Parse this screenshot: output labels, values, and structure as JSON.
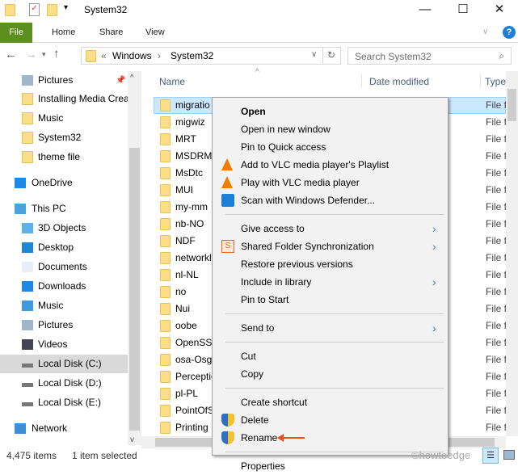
{
  "window": {
    "title": "System32",
    "minimize": "—",
    "maximize": "☐",
    "close": "✕"
  },
  "ribbon": {
    "tabs": [
      "File",
      "Home",
      "Share",
      "View"
    ],
    "help": "?"
  },
  "address": {
    "path": [
      "Windows",
      "System32"
    ],
    "prefix": "«",
    "search_placeholder": "Search System32"
  },
  "nav": [
    {
      "label": "Pictures",
      "icon": "pictures-icon",
      "pinned": true
    },
    {
      "label": "Installing Media Crea",
      "icon": "folder-icon"
    },
    {
      "label": "Music",
      "icon": "folder-icon"
    },
    {
      "label": "System32",
      "icon": "folder-icon"
    },
    {
      "label": "theme file",
      "icon": "folder-icon"
    },
    {
      "label": "OneDrive",
      "icon": "onedrive-icon"
    },
    {
      "label": "This PC",
      "icon": "this-pc-icon"
    },
    {
      "label": "3D Objects",
      "icon": "3d-objects-icon"
    },
    {
      "label": "Desktop",
      "icon": "desktop-icon"
    },
    {
      "label": "Documents",
      "icon": "documents-icon"
    },
    {
      "label": "Downloads",
      "icon": "downloads-icon"
    },
    {
      "label": "Music",
      "icon": "music-icon"
    },
    {
      "label": "Pictures",
      "icon": "pictures-icon"
    },
    {
      "label": "Videos",
      "icon": "videos-icon"
    },
    {
      "label": "Local Disk (C:)",
      "icon": "drive-icon",
      "selected": true
    },
    {
      "label": "Local Disk (D:)",
      "icon": "drive-icon"
    },
    {
      "label": "Local Disk (E:)",
      "icon": "drive-icon"
    },
    {
      "label": "Network",
      "icon": "network-icon"
    }
  ],
  "columns": {
    "name": "Name",
    "date": "Date modified",
    "type": "Type"
  },
  "files": [
    {
      "name": "migratio",
      "type": "File f"
    },
    {
      "name": "migwiz",
      "type": "File f"
    },
    {
      "name": "MRT",
      "type": "File f"
    },
    {
      "name": "MSDRM",
      "type": "File f"
    },
    {
      "name": "MsDtc",
      "type": "File f"
    },
    {
      "name": "MUI",
      "type": "File f"
    },
    {
      "name": "my-mm",
      "type": "File f"
    },
    {
      "name": "nb-NO",
      "type": "File f"
    },
    {
      "name": "NDF",
      "type": "File f"
    },
    {
      "name": "networkl",
      "type": "File f"
    },
    {
      "name": "nl-NL",
      "type": "File f"
    },
    {
      "name": "no",
      "type": "File f"
    },
    {
      "name": "Nui",
      "type": "File f"
    },
    {
      "name": "oobe",
      "type": "File f"
    },
    {
      "name": "OpenSSH",
      "type": "File f"
    },
    {
      "name": "osa-Osg",
      "type": "File f"
    },
    {
      "name": "Perceptio",
      "type": "File f"
    },
    {
      "name": "pl-PL",
      "type": "File f"
    },
    {
      "name": "PointOfS",
      "type": "File f"
    },
    {
      "name": "Printing",
      "type": "File f"
    }
  ],
  "menu": [
    {
      "label": "Open",
      "bold": true
    },
    {
      "label": "Open in new window"
    },
    {
      "label": "Pin to Quick access"
    },
    {
      "label": "Add to VLC media player's Playlist",
      "icon": "vlc-icon"
    },
    {
      "label": "Play with VLC media player",
      "icon": "vlc-icon"
    },
    {
      "label": "Scan with Windows Defender...",
      "icon": "defender-icon"
    },
    {
      "sep": true
    },
    {
      "label": "Give access to",
      "sub": true
    },
    {
      "label": "Shared Folder Synchronization",
      "icon": "sync-icon",
      "sub": true
    },
    {
      "label": "Restore previous versions"
    },
    {
      "label": "Include in library",
      "sub": true
    },
    {
      "label": "Pin to Start"
    },
    {
      "sep": true
    },
    {
      "label": "Send to",
      "sub": true
    },
    {
      "sep": true
    },
    {
      "label": "Cut"
    },
    {
      "label": "Copy"
    },
    {
      "sep": true
    },
    {
      "label": "Create shortcut"
    },
    {
      "label": "Delete",
      "icon": "shield-icon"
    },
    {
      "label": "Rename",
      "icon": "shield-icon",
      "arrow": true
    },
    {
      "sep": true
    },
    {
      "label": "Properties"
    }
  ],
  "status": {
    "count": "4,475 items",
    "selected": "1 item selected"
  },
  "watermark": "©howtoedge",
  "colors": {
    "file_tab": "#5d8f1f",
    "selection": "#cce8ff",
    "arrow": "#e8501c"
  }
}
